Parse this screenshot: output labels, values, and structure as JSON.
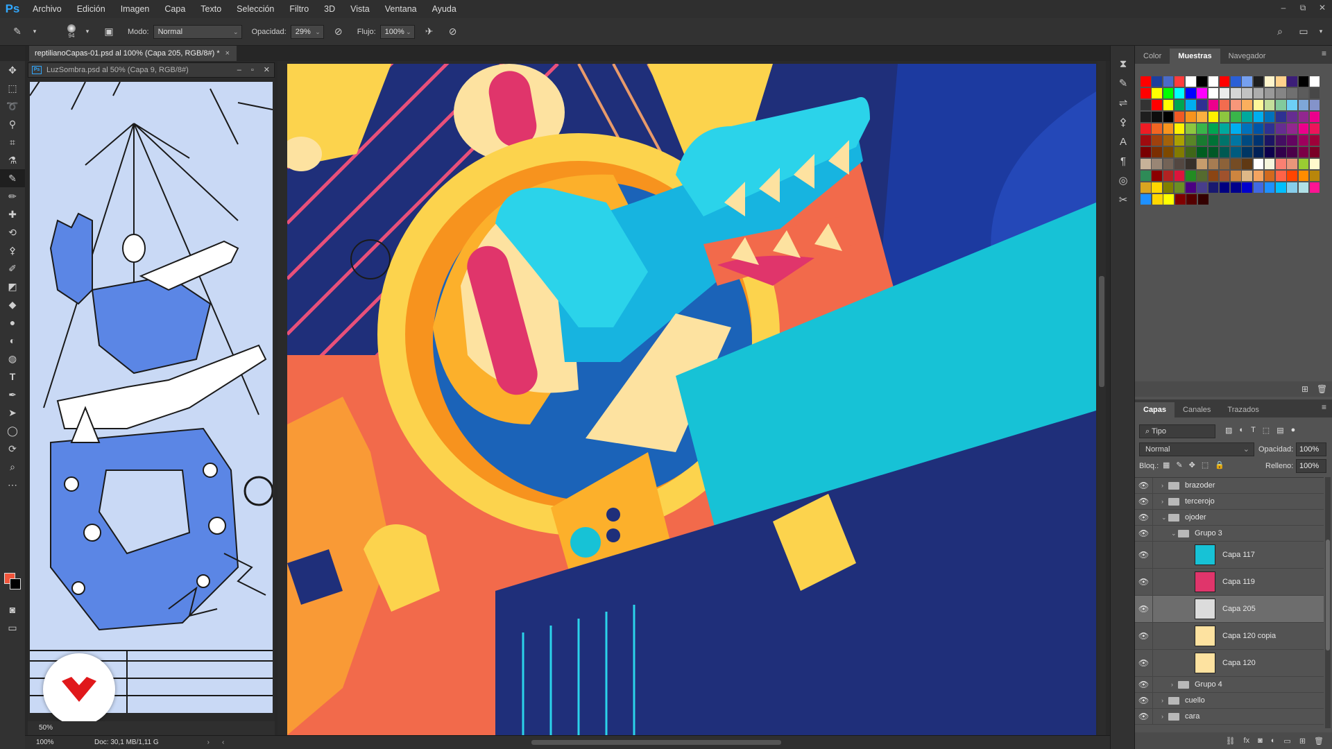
{
  "app": {
    "logo": "Ps"
  },
  "menu": [
    "Archivo",
    "Edición",
    "Imagen",
    "Capa",
    "Texto",
    "Selección",
    "Filtro",
    "3D",
    "Vista",
    "Ventana",
    "Ayuda"
  ],
  "window_controls": [
    "–",
    "⧉",
    "✕"
  ],
  "options": {
    "brush_size": "94",
    "mode_label": "Modo:",
    "mode_value": "Normal",
    "opacity_label": "Opacidad:",
    "opacity_value": "29%",
    "flow_label": "Flujo:",
    "flow_value": "100%"
  },
  "document_tabs": [
    {
      "label": "reptilianoCapas-01.psd al 100% (Capa 205, RGB/8#) *",
      "close": "×"
    }
  ],
  "floating_doc": {
    "title": "LuzSombra.psd al 50% (Capa 9, RGB/8#)",
    "zoom": "50%"
  },
  "statusbar": {
    "zoom": "100%",
    "doc_info": "Doc: 30,1 MB/1,11 G"
  },
  "swatch_panel": {
    "tabs": [
      "Color",
      "Muestras",
      "Navegador"
    ],
    "active_tab": "Muestras",
    "rows": [
      [
        "#ff0000",
        "#1d3f9e",
        "#4a6bc8",
        "#ff3c3c",
        "#ffffff",
        "#000000",
        "#ffffff",
        "#ff0000",
        "#2b5fd6",
        "#76a0f0",
        "#1e1e1e",
        "#fff5cc",
        "#ffd28c",
        "#3c1e78",
        "#000000",
        "#ffffff"
      ],
      [
        "#ff0000",
        "#ffff00",
        "#00ff00",
        "#00ffff",
        "#0000ff",
        "#ff00ff",
        "#ffffff",
        "#ebebeb",
        "#d6d6d6",
        "#c2c2c2",
        "#adadad",
        "#999999",
        "#858585",
        "#707070",
        "#5c5c5c",
        "#474747"
      ],
      [
        "#333333",
        "#ff0000",
        "#ffff00",
        "#00a651",
        "#00aeef",
        "#2e3192",
        "#ec008c",
        "#f26c4f",
        "#f7977a",
        "#fbaf5d",
        "#fff799",
        "#c4df9b",
        "#82ca9c",
        "#6dcff6",
        "#7ea7d8",
        "#8493ca"
      ],
      [
        "#1e1e1e",
        "#0d0d0d",
        "#000000",
        "#f15a24",
        "#f7941d",
        "#fbb040",
        "#fff200",
        "#8dc63f",
        "#39b54a",
        "#00a99d",
        "#00aeef",
        "#0072bc",
        "#2e3192",
        "#662d91",
        "#92278f",
        "#ec008c"
      ],
      [
        "#ed1c24",
        "#f26522",
        "#f7941d",
        "#fff200",
        "#8dc63f",
        "#39b54a",
        "#00a651",
        "#00a99d",
        "#00aeef",
        "#0072bc",
        "#0054a6",
        "#2e3192",
        "#662d91",
        "#92278f",
        "#ec008c",
        "#ed145b"
      ],
      [
        "#9e0b0f",
        "#a0410d",
        "#a3620a",
        "#aba000",
        "#598527",
        "#197b30",
        "#007236",
        "#00746b",
        "#0076a3",
        "#004a80",
        "#003471",
        "#1b1464",
        "#440e62",
        "#630460",
        "#9e005d",
        "#9e0039"
      ],
      [
        "#790000",
        "#7b2e00",
        "#7d4900",
        "#827b00",
        "#406618",
        "#005e20",
        "#005826",
        "#005952",
        "#005b7f",
        "#003663",
        "#002157",
        "#0d004c",
        "#32004b",
        "#4b0049",
        "#7b0046",
        "#7a0026"
      ],
      [
        "#c7b299",
        "#998675",
        "#736357",
        "#534741",
        "#37302a",
        "#c69c6d",
        "#a67c52",
        "#8c6239",
        "#754c24",
        "#603913",
        "#ffffff",
        "#f5f5dc",
        "#fa8072",
        "#e9967a",
        "#9acd32",
        "#fffacd"
      ],
      [
        "#2e8b57",
        "#8b0000",
        "#b22222",
        "#dc143c",
        "#228b22",
        "#556b2f",
        "#8b4513",
        "#a0522d",
        "#cd853f",
        "#deb887",
        "#f4a460",
        "#d2691e",
        "#ff6347",
        "#ff4500",
        "#ff8c00",
        "#b8860b"
      ],
      [
        "#daa520",
        "#ffd700",
        "#808000",
        "#6b8e23",
        "#4b0082",
        "#483d8b",
        "#191970",
        "#000080",
        "#00008b",
        "#0000cd",
        "#4169e1",
        "#1e90ff",
        "#00bfff",
        "#87ceeb",
        "#b0e0e6",
        "#ff1493"
      ],
      [
        "#1e90ff",
        "#ffd700",
        "#ffff00",
        "#800000",
        "#550000",
        "#330000"
      ]
    ]
  },
  "layers_panel": {
    "tabs": [
      "Capas",
      "Canales",
      "Trazados"
    ],
    "active_tab": "Capas",
    "filter": "Tipo",
    "blend_mode": "Normal",
    "opacity_label": "Opacidad:",
    "opacity_value": "100%",
    "lock_label": "Bloq.:",
    "fill_label": "Relleno:",
    "fill_value": "100%",
    "layers": [
      {
        "name": "brazoder",
        "kind": "folder",
        "indent": 0,
        "expanded": false,
        "selected": false
      },
      {
        "name": "tercerojo",
        "kind": "folder",
        "indent": 0,
        "expanded": false,
        "selected": false
      },
      {
        "name": "ojoder",
        "kind": "folder",
        "indent": 0,
        "expanded": true,
        "selected": false
      },
      {
        "name": "Grupo 3",
        "kind": "folder",
        "indent": 1,
        "expanded": true,
        "selected": false
      },
      {
        "name": "Capa 117",
        "kind": "layer",
        "indent": 2,
        "thumb": "#17c2d6",
        "selected": false
      },
      {
        "name": "Capa 119",
        "kind": "layer",
        "indent": 2,
        "thumb": "#e0356b",
        "selected": false
      },
      {
        "name": "Capa 205",
        "kind": "layer",
        "indent": 2,
        "thumb": "#dcdcdc",
        "selected": true
      },
      {
        "name": "Capa 120 copia",
        "kind": "layer",
        "indent": 2,
        "thumb": "#fde2a0",
        "selected": false
      },
      {
        "name": "Capa 120",
        "kind": "layer",
        "indent": 2,
        "thumb": "#fde2a0",
        "selected": false
      },
      {
        "name": "Grupo 4",
        "kind": "folder",
        "indent": 1,
        "expanded": false,
        "selected": false
      },
      {
        "name": "cuello",
        "kind": "folder",
        "indent": 0,
        "expanded": false,
        "selected": false
      },
      {
        "name": "cara",
        "kind": "folder",
        "indent": 0,
        "expanded": false,
        "selected": false
      }
    ]
  }
}
